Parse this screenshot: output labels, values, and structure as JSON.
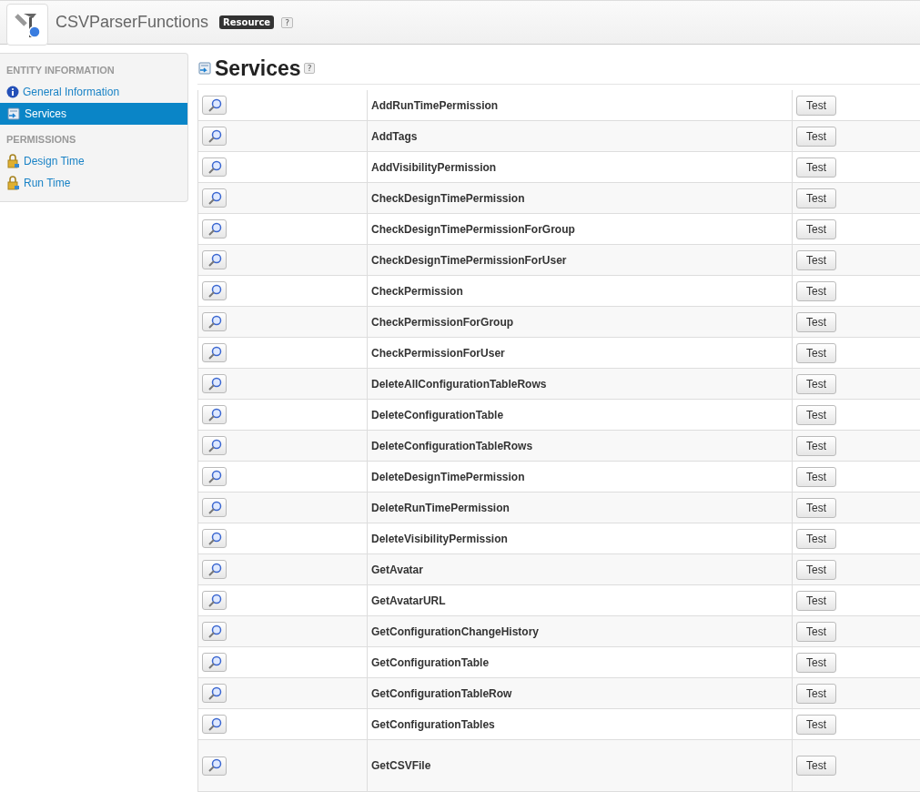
{
  "header": {
    "title": "CSVParserFunctions",
    "badge": "Resource",
    "help": "?"
  },
  "sidebar": {
    "sections": [
      {
        "heading": "ENTITY INFORMATION",
        "items": [
          {
            "label": "General Information",
            "kind": "info",
            "selected": false
          },
          {
            "label": "Services",
            "kind": "services",
            "selected": true
          }
        ]
      },
      {
        "heading": "PERMISSIONS",
        "items": [
          {
            "label": "Design Time",
            "kind": "lock",
            "selected": false
          },
          {
            "label": "Run Time",
            "kind": "lock",
            "selected": false
          }
        ]
      }
    ]
  },
  "page": {
    "title": "Services",
    "help": "?"
  },
  "services": [
    {
      "name": "AddRunTimePermission",
      "test": "Test"
    },
    {
      "name": "AddTags",
      "test": "Test"
    },
    {
      "name": "AddVisibilityPermission",
      "test": "Test"
    },
    {
      "name": "CheckDesignTimePermission",
      "test": "Test"
    },
    {
      "name": "CheckDesignTimePermissionForGroup",
      "test": "Test"
    },
    {
      "name": "CheckDesignTimePermissionForUser",
      "test": "Test"
    },
    {
      "name": "CheckPermission",
      "test": "Test"
    },
    {
      "name": "CheckPermissionForGroup",
      "test": "Test"
    },
    {
      "name": "CheckPermissionForUser",
      "test": "Test"
    },
    {
      "name": "DeleteAllConfigurationTableRows",
      "test": "Test"
    },
    {
      "name": "DeleteConfigurationTable",
      "test": "Test"
    },
    {
      "name": "DeleteConfigurationTableRows",
      "test": "Test"
    },
    {
      "name": "DeleteDesignTimePermission",
      "test": "Test"
    },
    {
      "name": "DeleteRunTimePermission",
      "test": "Test"
    },
    {
      "name": "DeleteVisibilityPermission",
      "test": "Test"
    },
    {
      "name": "GetAvatar",
      "test": "Test"
    },
    {
      "name": "GetAvatarURL",
      "test": "Test"
    },
    {
      "name": "GetConfigurationChangeHistory",
      "test": "Test"
    },
    {
      "name": "GetConfigurationTable",
      "test": "Test"
    },
    {
      "name": "GetConfigurationTableRow",
      "test": "Test"
    },
    {
      "name": "GetConfigurationTables",
      "test": "Test"
    },
    {
      "name": "GetCSVFile",
      "test": "Test"
    }
  ]
}
